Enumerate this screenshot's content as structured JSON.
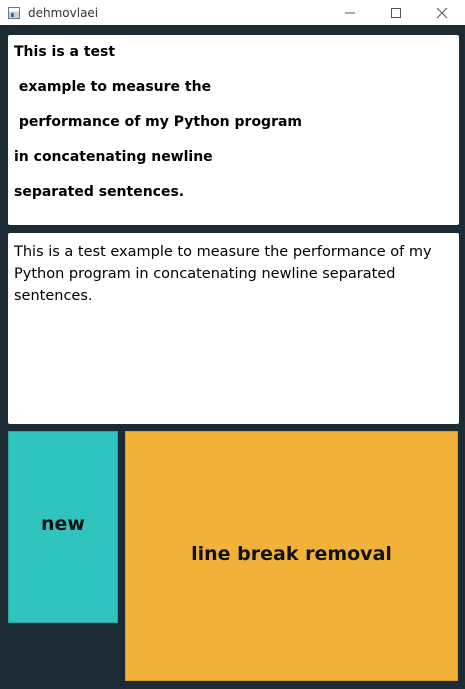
{
  "window": {
    "title": "dehmovlaei",
    "icon": "app-window-icon",
    "controls": [
      "minimize-icon",
      "maximize-icon",
      "close-icon"
    ]
  },
  "input_text": {
    "lines": [
      "This is a test",
      " example to measure the",
      " performance of my Python program",
      "in concatenating newline",
      "separated sentences."
    ]
  },
  "output_text": {
    "value": "This is a test  example to measure the  performance of my Python program in concatenating newline separated sentences."
  },
  "buttons": {
    "new_label": "new",
    "remove_label": "line break removal"
  },
  "colors": {
    "background": "#1c2a33",
    "new_button": "#2fc4bf",
    "remove_button": "#f2b138",
    "panel": "#ffffff"
  }
}
